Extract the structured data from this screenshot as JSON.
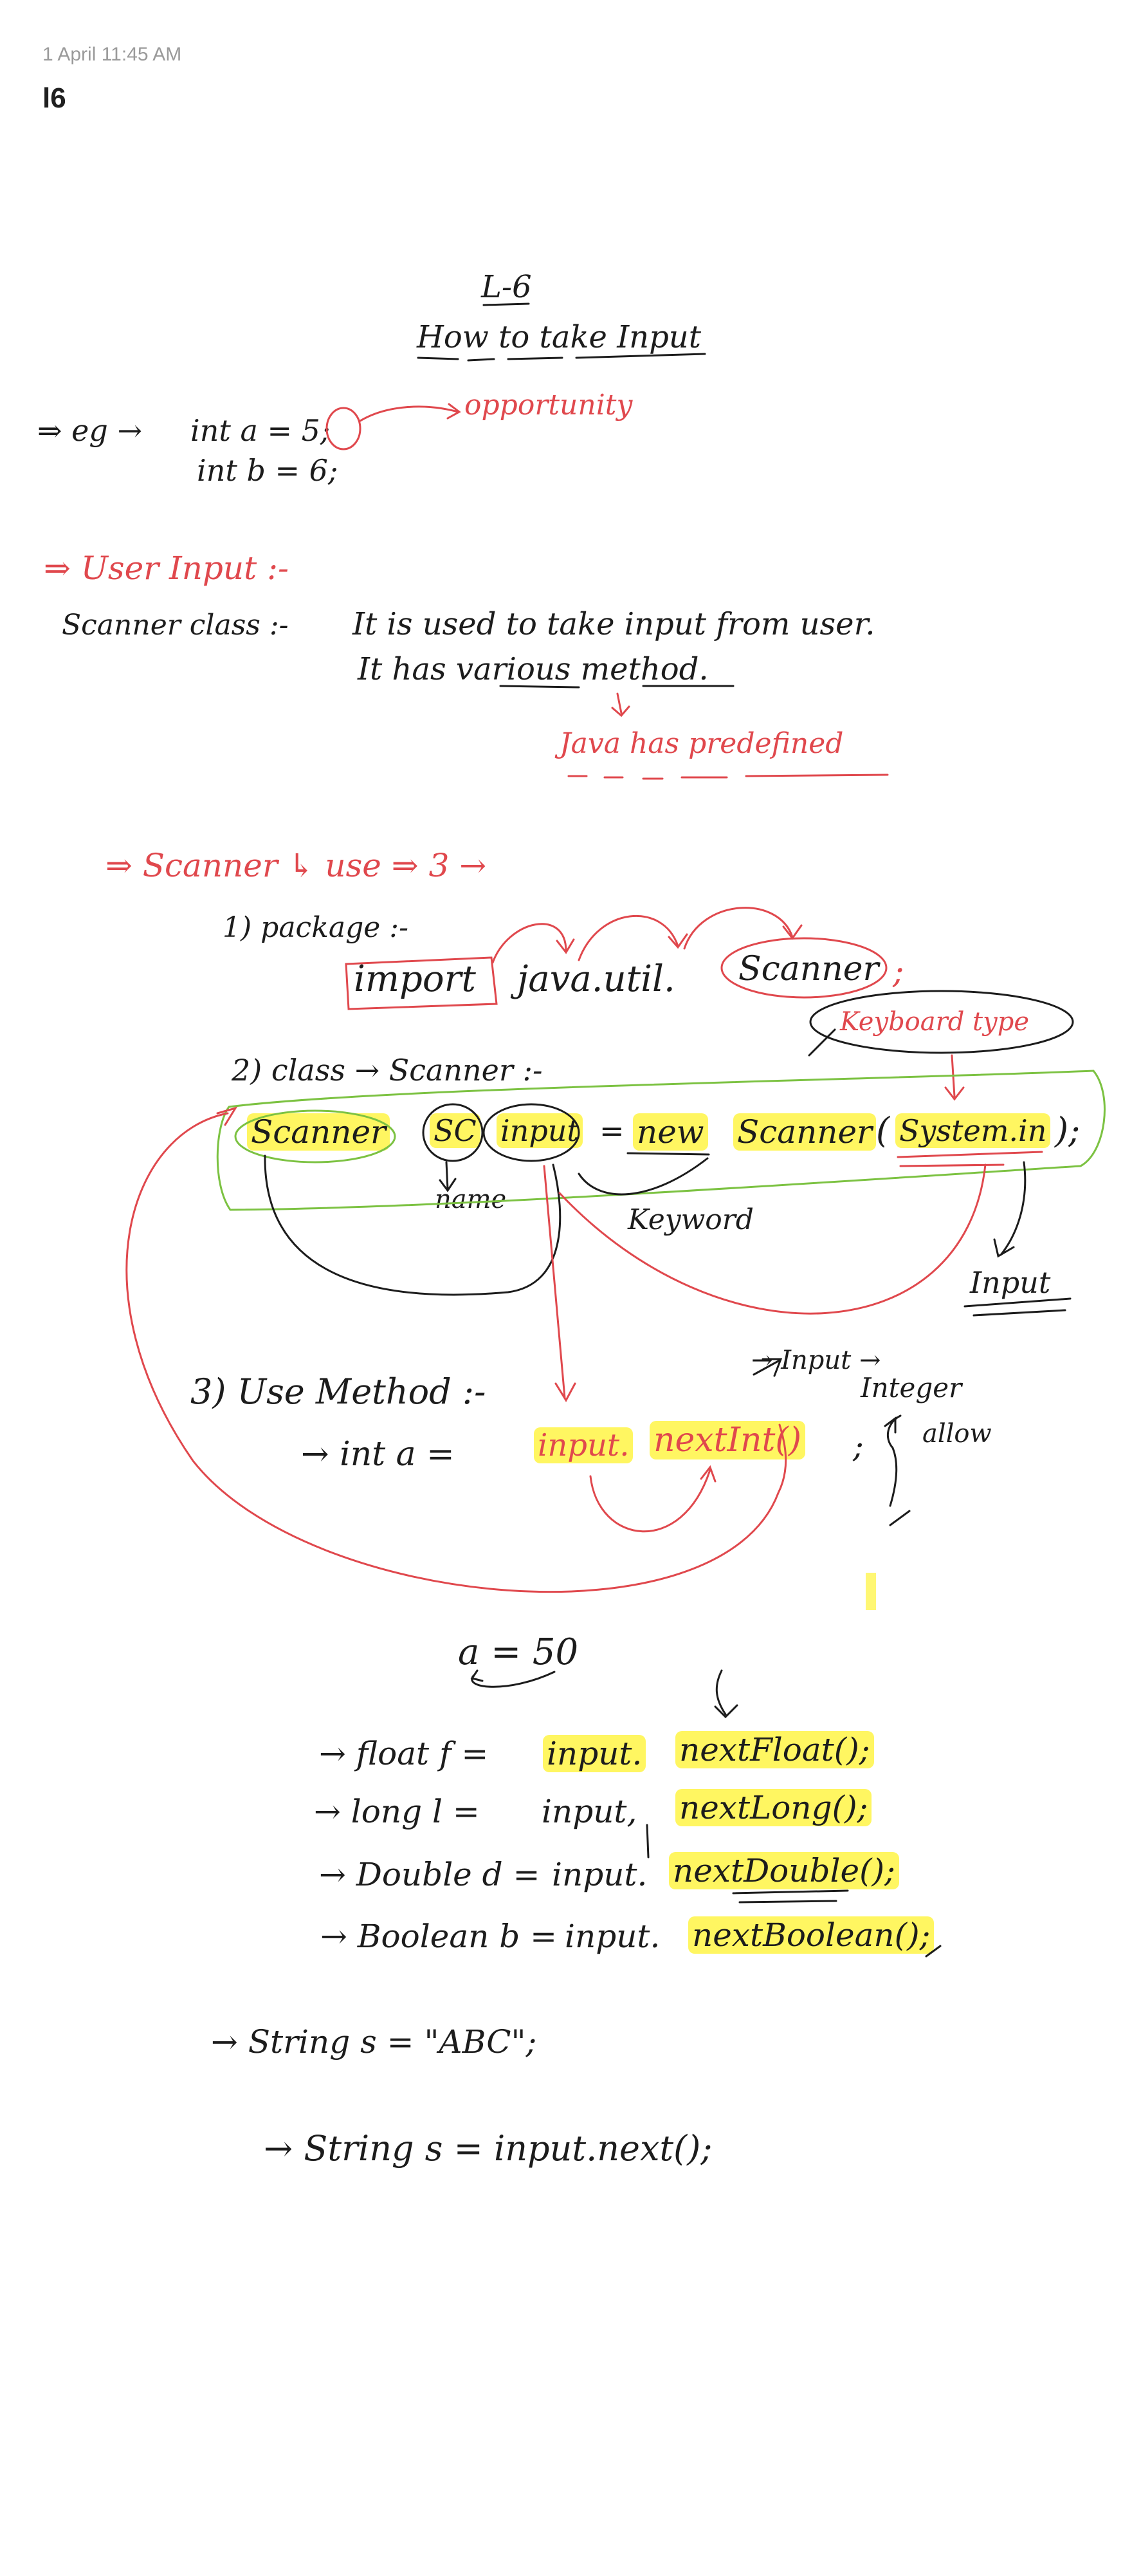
{
  "note": {
    "timestamp": "1 April 11:45 AM",
    "title": "l6"
  },
  "content": {
    "lecture": "L-6",
    "heading": "How to take Input",
    "example": {
      "prefix": "⇒ eg →",
      "line1": "int a = 5;",
      "line2": "int b = 6;",
      "annotation": "opportunity"
    },
    "user_input_heading": "⇒ User Input :-",
    "scanner_class": {
      "label": "Scanner class :-",
      "desc1": "It is used to take input from user.",
      "desc2": "It has various method.",
      "note": "Java has predefined"
    },
    "scanner_use": "⇒ Scanner ↳ use ⇒ 3 →",
    "step1": {
      "label": "1) package :-",
      "import_kw": "import",
      "import_path": "java.util.",
      "import_class": "Scanner",
      "semicolon": ";"
    },
    "step2": {
      "label": "2) class → Scanner :-",
      "keyboard_type": "Keyboard type",
      "t_scanner": "Scanner",
      "t_sc": "SC",
      "t_input": "input",
      "t_eq": "=",
      "t_new": "new",
      "t_scanner2": "Scanner",
      "t_open": "(",
      "t_system_in": "System.in",
      "t_close": ");",
      "name_label": "name",
      "keyword_label": "Keyword",
      "input_label": "Input"
    },
    "step3": {
      "label": "3) Use Method :-",
      "input_arrow": "→ Input →",
      "integer": "Integer",
      "allow": "allow",
      "prefix": "→ int a =",
      "call_obj": "input.",
      "call_method": "nextInt()",
      "semicolon": ";",
      "a_value": "a = 50"
    },
    "methods": [
      {
        "prefix": "→ float f =",
        "obj": "input.",
        "method": "nextFloat();"
      },
      {
        "prefix": "→ long l =",
        "obj": "input,",
        "method": "nextLong();"
      },
      {
        "prefix": "→ Double d =",
        "obj": "input.",
        "method": "nextDouble();"
      },
      {
        "prefix": "→ Boolean b =",
        "obj": "input.",
        "method": "nextBoolean();"
      }
    ],
    "string_literal": "→ String s = \"ABC\";",
    "string_next": "→ String s = input.next();"
  },
  "colors": {
    "ink_black": "#1c1c1c",
    "ink_red": "#e0484d",
    "ink_green": "#7cc242",
    "highlight_yellow": "#fff000",
    "meta_gray": "#9a9a9a"
  }
}
